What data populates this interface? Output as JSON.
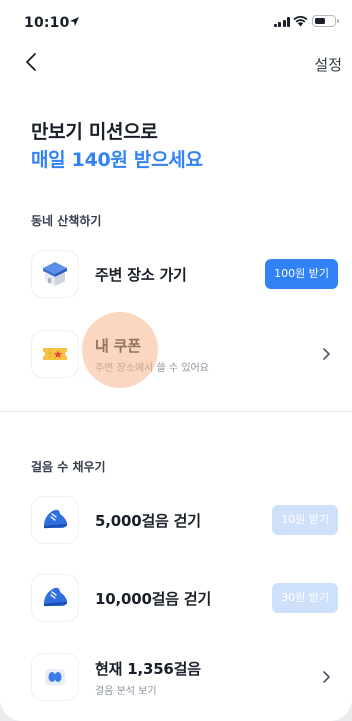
{
  "status_bar": {
    "time": "10:10"
  },
  "nav": {
    "settings_label": "설정"
  },
  "header": {
    "title_line1": "만보기 미션으로",
    "title_line2": "매일 140원 받으세요"
  },
  "walk_section": {
    "label": "동네 산책하기",
    "items": [
      {
        "label": "주변 장소 가기",
        "button": "100원 받기",
        "icon": "box-icon"
      },
      {
        "label": "내 쿠폰",
        "sub": "주변 장소에서 쓸 수 있어요",
        "icon": "ticket-icon"
      }
    ]
  },
  "steps_section": {
    "label": "걸음 수 채우기",
    "items": [
      {
        "label": "5,000걸음 걷기",
        "button": "10원 받기",
        "icon": "sneaker-icon"
      },
      {
        "label": "10,000걸음 걷기",
        "button": "30원 받기",
        "icon": "sneaker-icon"
      },
      {
        "label": "현재 1,356걸음",
        "sub": "걸음 분석 보기",
        "icon": "footprints-icon"
      }
    ]
  },
  "colors": {
    "accent": "#3182f6",
    "accent_disabled": "#cfe0fb",
    "text": "#191f28",
    "subtext": "#8b95a1"
  }
}
